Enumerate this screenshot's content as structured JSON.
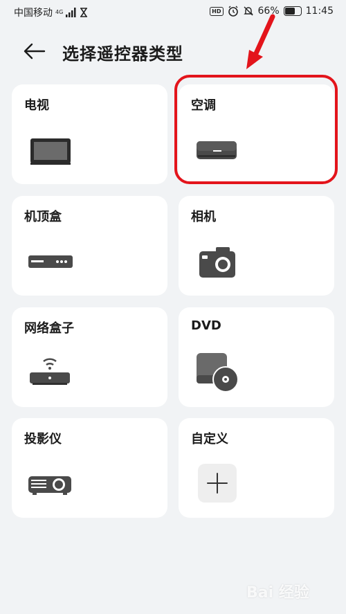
{
  "status_bar": {
    "carrier": "中国移动",
    "network": "4G",
    "battery": "66%",
    "time": "11:45",
    "hd_badge": "HD"
  },
  "header": {
    "title": "选择遥控器类型",
    "back_icon": "arrow-left-icon"
  },
  "devices": [
    {
      "label": "电视",
      "icon": "tv-icon"
    },
    {
      "label": "空调",
      "icon": "air-conditioner-icon"
    },
    {
      "label": "机顶盒",
      "icon": "set-top-box-icon"
    },
    {
      "label": "相机",
      "icon": "camera-icon"
    },
    {
      "label": "网络盒子",
      "icon": "network-box-icon"
    },
    {
      "label": "DVD",
      "icon": "dvd-icon"
    },
    {
      "label": "投影仪",
      "icon": "projector-icon"
    },
    {
      "label": "自定义",
      "icon": "plus-icon"
    }
  ],
  "annotation": {
    "color": "#e3141b"
  },
  "watermark": {
    "text": "Bai 经验"
  }
}
